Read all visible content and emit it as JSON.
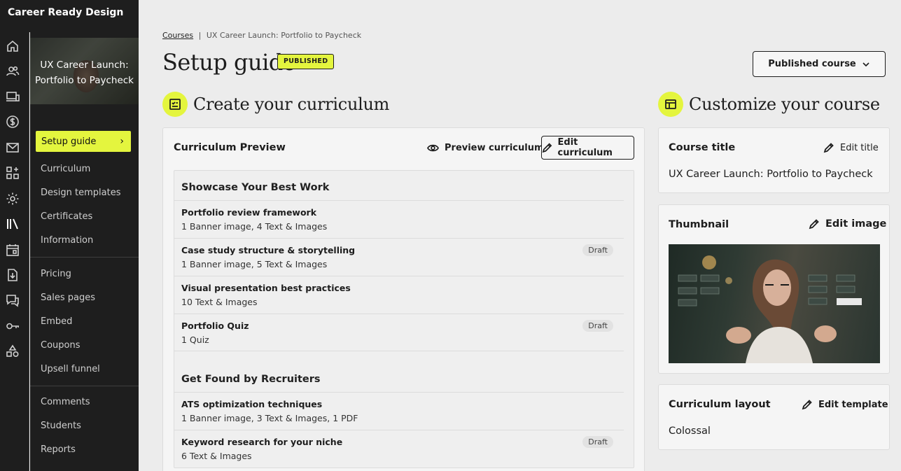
{
  "brand": {
    "name": "Career Ready Design"
  },
  "rail_icons": [
    "home-icon",
    "users-icon",
    "devices-icon",
    "dollar-icon",
    "mail-icon",
    "apps-icon",
    "gear-icon",
    "library-icon",
    "calendar-icon",
    "download-icon",
    "chat-icon",
    "key-icon",
    "shapes-icon"
  ],
  "sidebar": {
    "course_title": "UX Career Launch: Portfolio to Paycheck",
    "active": "Setup guide",
    "group1": [
      "Curriculum",
      "Design templates",
      "Certificates",
      "Information"
    ],
    "group2": [
      "Pricing",
      "Sales pages",
      "Embed",
      "Coupons",
      "Upsell funnel"
    ],
    "group3": [
      "Comments",
      "Students",
      "Reports"
    ]
  },
  "breadcrumb": {
    "root": "Courses",
    "separator": "|",
    "current": "UX Career Launch: Portfolio to Paycheck"
  },
  "header": {
    "title": "Setup guide",
    "badge": "PUBLISHED",
    "status_button": "Published course"
  },
  "curriculum_section": {
    "heading": "Create your curriculum",
    "card_title": "Curriculum Preview",
    "preview_button": "Preview curriculum",
    "edit_button": "Edit curriculum",
    "modules": [
      {
        "title": "Showcase Your Best Work",
        "lessons": [
          {
            "name": "Portfolio review framework",
            "meta": "1 Banner image, 4 Text & Images",
            "status": ""
          },
          {
            "name": "Case study structure & storytelling",
            "meta": "1 Banner image, 5 Text & Images",
            "status": "Draft"
          },
          {
            "name": "Visual presentation best practices",
            "meta": "10 Text & Images",
            "status": ""
          },
          {
            "name": "Portfolio Quiz",
            "meta": "1 Quiz",
            "status": "Draft"
          }
        ]
      },
      {
        "title": "Get Found by Recruiters",
        "lessons": [
          {
            "name": "ATS optimization techniques",
            "meta": "1 Banner image, 3 Text & Images, 1 PDF",
            "status": ""
          },
          {
            "name": "Keyword research for your niche",
            "meta": "6 Text & Images",
            "status": "Draft"
          }
        ]
      }
    ]
  },
  "customize_section": {
    "heading": "Customize your course",
    "course_title": {
      "label": "Course title",
      "action": "Edit title",
      "value": "UX Career Launch: Portfolio to Paycheck"
    },
    "thumbnail": {
      "label": "Thumbnail",
      "action": "Edit image"
    },
    "layout": {
      "label": "Curriculum layout",
      "action": "Edit template",
      "value": "Colossal"
    }
  },
  "colors": {
    "accent": "#e4f53e",
    "sidebar": "#1e1e1e",
    "background": "#ececec"
  }
}
